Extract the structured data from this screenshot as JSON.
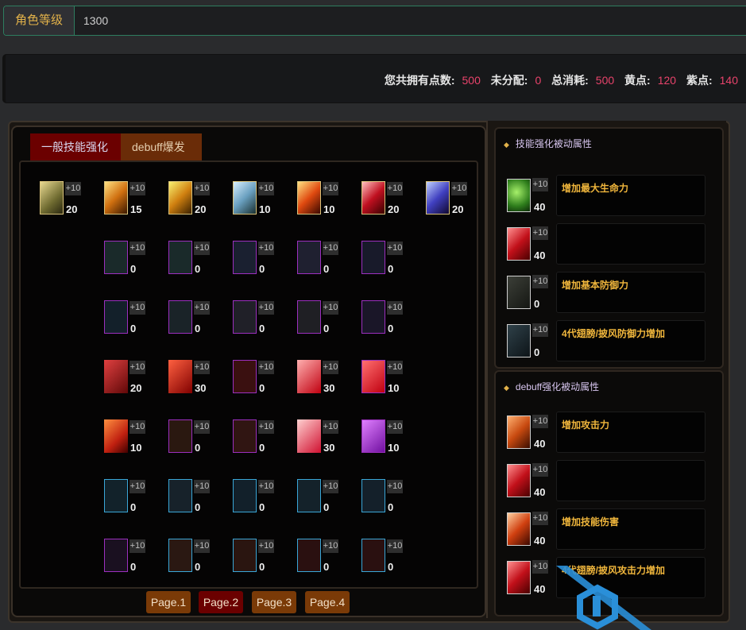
{
  "level": {
    "label": "角色等级",
    "value": "1300"
  },
  "points": {
    "total_label": "您共拥有点数:",
    "total": "500",
    "unassigned_label": "未分配:",
    "unassigned": "0",
    "consumed_label": "总消耗:",
    "consumed": "500",
    "yellow_label": "黄点:",
    "yellow": "120",
    "purple_label": "紫点:",
    "purple": "140"
  },
  "tabs": [
    "一般技能强化",
    "debuff爆发"
  ],
  "plus_label": "+10",
  "skills": [
    [
      "20",
      "15",
      "20",
      "10",
      "10",
      "20",
      "20"
    ],
    [
      "0",
      "0",
      "0",
      "0",
      "0"
    ],
    [
      "0",
      "0",
      "0",
      "0",
      "0"
    ],
    [
      "20",
      "30",
      "0",
      "30",
      "10"
    ],
    [
      "10",
      "0",
      "0",
      "30",
      "10"
    ],
    [
      "0",
      "0",
      "0",
      "0",
      "0"
    ],
    [
      "0",
      "0",
      "0",
      "0",
      "0"
    ]
  ],
  "pages": [
    "Page.1",
    "Page.2",
    "Page.3",
    "Page.4"
  ],
  "passive_sections": [
    {
      "title": "技能强化被动属性",
      "items": [
        {
          "value": "40",
          "desc": "增加最大生命力",
          "plus": "+10"
        },
        {
          "value": "40",
          "desc": "",
          "plus": "+10"
        },
        {
          "value": "0",
          "desc": "增加基本防御力",
          "plus": "+10"
        },
        {
          "value": "0",
          "desc": "4代翅膀/披风防御力增加",
          "plus": "+10"
        }
      ]
    },
    {
      "title": "debuff强化被动属性",
      "items": [
        {
          "value": "40",
          "desc": "增加攻击力",
          "plus": "+10"
        },
        {
          "value": "40",
          "desc": "",
          "plus": "+10"
        },
        {
          "value": "40",
          "desc": "增加技能伤害",
          "plus": "+10"
        },
        {
          "value": "40",
          "desc": "4代翅膀/披风攻击力增加",
          "plus": "+10"
        }
      ]
    }
  ],
  "colors": {
    "accent_red": "#e8436b",
    "gold_text": "#e2b24a",
    "tab_active": "#6b0000",
    "tab_inactive": "#6a2c08",
    "passive_desc": "#f0b63c"
  }
}
